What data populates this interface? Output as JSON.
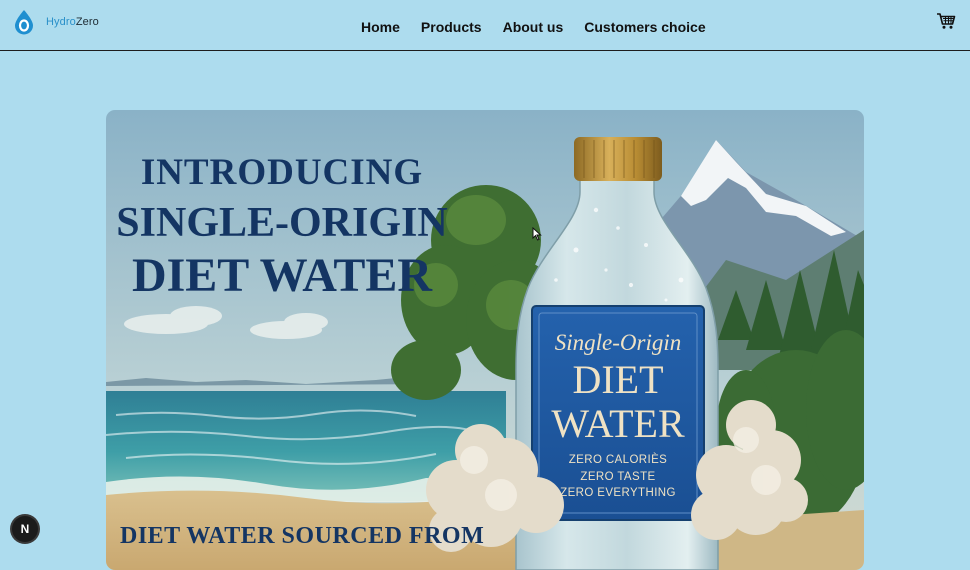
{
  "brand": {
    "name_part1": "Hydro",
    "name_part2": "Zero"
  },
  "nav": {
    "items": [
      "Home",
      "Products",
      "About us",
      "Customers choice"
    ]
  },
  "hero": {
    "headline_line1": "INTRODUCING",
    "headline_line2": "SINGLE-ORIGIN",
    "headline_line3": "DIET WATER",
    "subheadline": "DIET WATER SOURCED FROM",
    "bottle_label": {
      "script": "Single-Origin",
      "line1": "DIET",
      "line2": "WATER",
      "tagline1": "ZERO CALORIÈS",
      "tagline2": "ZERO TASTE",
      "tagline3": "ZERO EVERYTHING"
    }
  },
  "dev_badge": {
    "letter": "N"
  },
  "icons": [
    "water-drop-logo-icon",
    "shopping-cart-icon",
    "mouse-pointer-icon"
  ],
  "colors": {
    "background": "#addcee",
    "headline": "#143563",
    "brand_blue": "#2a90c9",
    "label_blue": "#1f5ba7"
  }
}
